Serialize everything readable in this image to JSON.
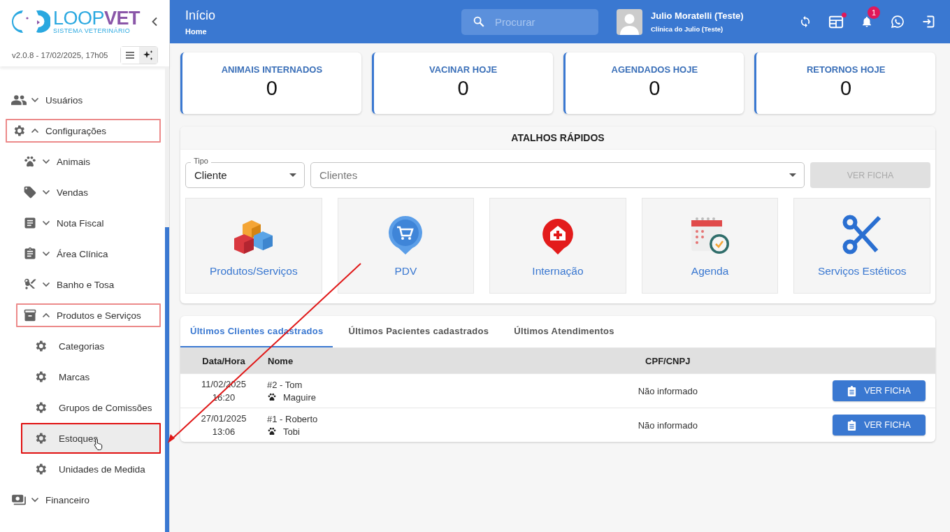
{
  "sidebar": {
    "logo": {
      "name_main": "LOOP",
      "name_accent": "VET",
      "tagline": "SISTEMA VETERINÁRIO"
    },
    "version": "v2.0.8 - 17/02/2025, 17h05",
    "items": [
      {
        "label": "Usuários",
        "expanded": false,
        "highlighted": false
      },
      {
        "label": "Configurações",
        "expanded": true,
        "highlighted": true,
        "children": [
          {
            "label": "Animais",
            "expanded": false,
            "highlighted": false
          },
          {
            "label": "Vendas",
            "expanded": false,
            "highlighted": false
          },
          {
            "label": "Nota Fiscal",
            "expanded": false,
            "highlighted": false
          },
          {
            "label": "Área Clínica",
            "expanded": false,
            "highlighted": false
          },
          {
            "label": "Banho e Tosa",
            "expanded": false,
            "highlighted": false
          },
          {
            "label": "Produtos e Serviços",
            "expanded": true,
            "highlighted": true,
            "children": [
              {
                "label": "Categorias",
                "highlighted": false,
                "hovered": false
              },
              {
                "label": "Marcas",
                "highlighted": false,
                "hovered": false
              },
              {
                "label": "Grupos de Comissões",
                "highlighted": false,
                "hovered": false
              },
              {
                "label": "Estoques",
                "highlighted": true,
                "hovered": true
              },
              {
                "label": "Unidades de Medida",
                "highlighted": false,
                "hovered": false
              }
            ]
          }
        ]
      },
      {
        "label": "Financeiro",
        "expanded": false,
        "highlighted": false
      }
    ]
  },
  "header": {
    "title": "Início",
    "breadcrumb": "Home",
    "search": {
      "placeholder": "Procurar"
    },
    "user": {
      "name": "Julio Moratelli (Teste)",
      "clinic": "Clínica do Julio (Teste)"
    },
    "notifications": {
      "count": "1"
    }
  },
  "stats": [
    {
      "label": "ANIMAIS INTERNADOS",
      "value": "0"
    },
    {
      "label": "VACINAR HOJE",
      "value": "0"
    },
    {
      "label": "AGENDADOS HOJE",
      "value": "0"
    },
    {
      "label": "RETORNOS HOJE",
      "value": "0"
    }
  ],
  "shortcuts": {
    "title": "ATALHOS RÁPIDOS",
    "type_field": {
      "label": "Tipo",
      "value": "Cliente"
    },
    "client_field": {
      "placeholder": "Clientes"
    },
    "button": {
      "label": "VER FICHA",
      "disabled": true
    },
    "tiles": [
      {
        "label": "Produtos/Serviços",
        "kind": "cubes"
      },
      {
        "label": "PDV",
        "kind": "cart"
      },
      {
        "label": "Internação",
        "kind": "hospital"
      },
      {
        "label": "Agenda",
        "kind": "calendar"
      },
      {
        "label": "Serviços Estéticos",
        "kind": "scissors"
      }
    ]
  },
  "recent": {
    "tabs": [
      {
        "label": "Últimos Clientes cadastrados",
        "selected": true
      },
      {
        "label": "Últimos Pacientes cadastrados",
        "selected": false
      },
      {
        "label": "Últimos Atendimentos",
        "selected": false
      }
    ],
    "columns": [
      "Data/Hora",
      "Nome",
      "CPF/CNPJ"
    ],
    "rows": [
      {
        "date": "11/02/2025",
        "time": "16:20",
        "name": "#2 - Tom",
        "pet": "Maguire",
        "document": "Não informado",
        "action": "VER FICHA"
      },
      {
        "date": "27/01/2025",
        "time": "13:06",
        "name": "#1 - Roberto",
        "pet": "Tobi",
        "document": "Não informado",
        "action": "VER FICHA"
      }
    ]
  }
}
